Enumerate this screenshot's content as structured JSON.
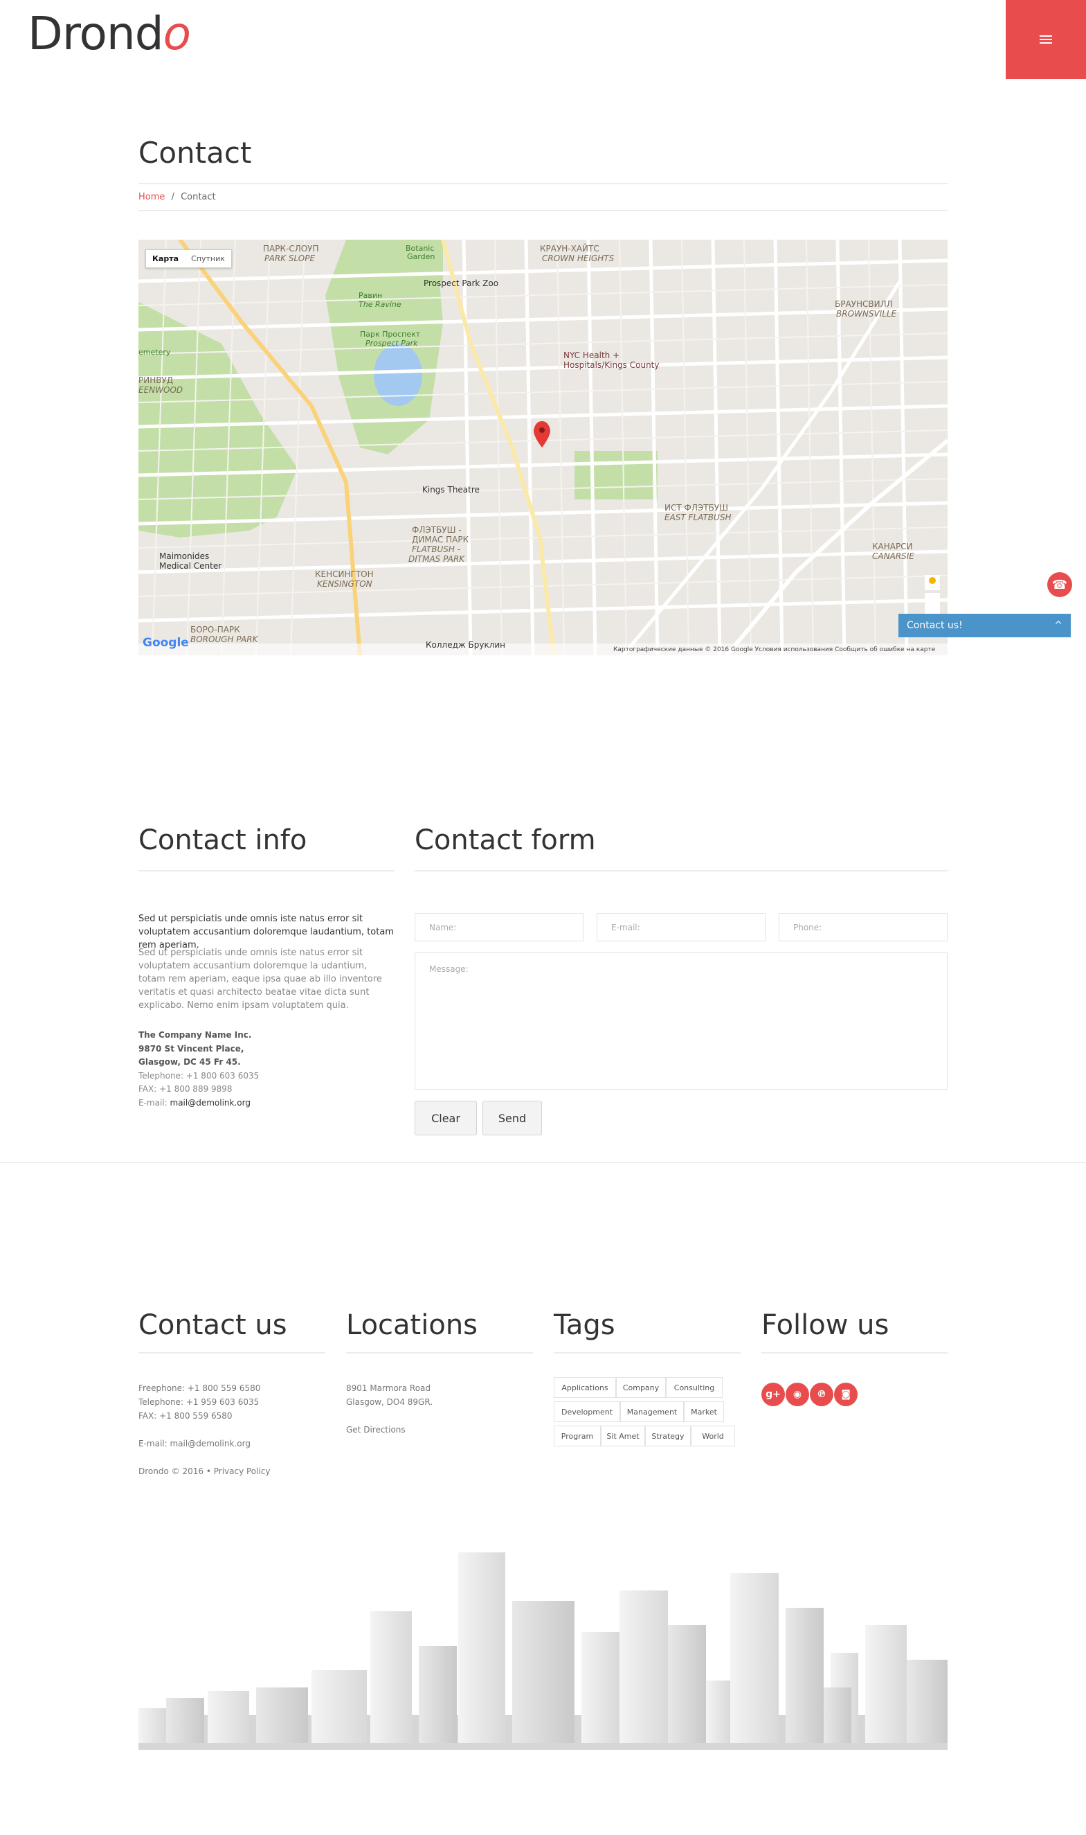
{
  "header": {
    "logo_main": "Drond",
    "logo_accent": "o",
    "menu_icon": "hamburger-icon",
    "accent_color": "#e84c4c"
  },
  "page": {
    "title": "Contact",
    "breadcrumb": {
      "home": "Home",
      "separator": "/",
      "current": "Contact"
    }
  },
  "map": {
    "tabs": [
      "Карта",
      "Спутник"
    ],
    "active_tab": "Карта",
    "labels": {
      "park_slope": "ПАРК-СЛОУП",
      "park_slope2": "PARK SLOPE",
      "crown_heights": "КРАУН-ХАЙТС",
      "crown_heights2": "CROWN HEIGHTS",
      "prospect_zoo": "Prospect Park Zoo",
      "prospect_park": "Парк Проспект",
      "prospect_park2": "Prospect Park",
      "ravine": "Равин",
      "ravine2": "The Ravine",
      "botanic": "Botanic",
      "botanic2": "Garden",
      "nyc_health": "NYC Health +",
      "nyc_health2": "Hospitals/Kings County",
      "brownsville": "БРАУНСВИЛЛ",
      "brownsville2": "BROWNSVILLE",
      "windsor": "РИНВУД",
      "windsor2": "EENWOOD",
      "kings_theatre": "Kings Theatre",
      "flatbush": "ФЛЭТБУШ -",
      "flatbush2": "ДИМАС ПАРК",
      "flatbush3": "FLATBUSH -",
      "flatbush4": "DITMAS PARK",
      "east_flatbush": "ИСТ ФЛЭТБУШ",
      "east_flatbush2": "EAST FLATBUSH",
      "kensington": "КЕНСИНГТОН",
      "kensington2": "KENSINGTON",
      "maimonides": "Maimonides",
      "maimonides2": "Medical Center",
      "borough_park": "БОРО-ПАРК",
      "borough_park2": "BOROUGH PARK",
      "canarsie": "КАНАРСИ",
      "canarsie2": "CANARSIE",
      "brooklyn_college": "Колледж Бруклин",
      "cemetery": "emetery",
      "google": "Google",
      "footer": "Картографические данные © 2016 Google   Условия использования   Сообщить об ошибке на карте"
    }
  },
  "widget": {
    "contact_us": "Contact us!",
    "chevron": "^"
  },
  "contact_info": {
    "heading": "Contact info",
    "lead": "Sed ut perspiciatis unde omnis iste natus error sit voluptatem accusantium doloremque laudantium, totam rem aperiam.",
    "body": "Sed ut perspiciatis unde omnis iste natus error sit voluptatem accusantium doloremque la udantium, totam rem aperiam, eaque ipsa quae ab illo inventore veritatis et quasi architecto beatae vitae dicta sunt explicabo. Nemo enim ipsam voluptatem quia.",
    "company": "The Company Name Inc.",
    "street": "9870 St Vincent Place,",
    "city": "Glasgow, DC 45 Fr 45.",
    "telephone": "Telephone: +1 800 603 6035",
    "fax": "FAX: +1 800 889 9898",
    "email_label": "E-mail:",
    "email": "mail@demolink.org"
  },
  "contact_form": {
    "heading": "Contact form",
    "name_placeholder": "Name:",
    "email_placeholder": "E-mail:",
    "phone_placeholder": "Phone:",
    "message_placeholder": "Message:",
    "clear": "Clear",
    "send": "Send"
  },
  "footer": {
    "contact": {
      "heading": "Contact us",
      "freephone": "Freephone: +1 800 559 6580",
      "telephone": "Telephone: +1 959 603 6035",
      "fax": "FAX: +1 800 559 6580",
      "email": "E-mail: mail@demolink.org",
      "copyright_brand": "Drondo",
      "copyright_year": "© 2016 •",
      "privacy": "Privacy Policy"
    },
    "locations": {
      "heading": "Locations",
      "line1": "8901 Marmora Road",
      "line2": "Glasgow, DO4 89GR.",
      "directions": "Get Directions"
    },
    "tags": {
      "heading": "Tags",
      "items": [
        "Applications",
        "Company",
        "Consulting",
        "Development",
        "Management",
        "Market",
        "Program",
        "Sit Amet",
        "Strategy",
        "World"
      ]
    },
    "follow": {
      "heading": "Follow us",
      "icons": [
        "google-plus-icon",
        "rss-icon",
        "pinterest-icon",
        "instagram-icon"
      ],
      "glyphs": [
        "g+",
        "◉",
        "℗",
        "◙"
      ]
    }
  }
}
